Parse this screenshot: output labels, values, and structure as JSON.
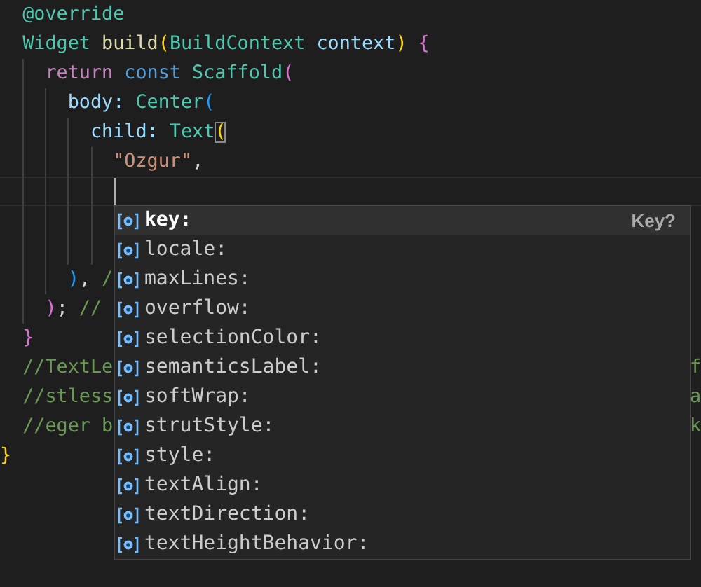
{
  "editor": {
    "lines": [
      {
        "tokens": [
          {
            "text": "  @override",
            "kind": "annotation"
          }
        ]
      },
      {
        "tokens": [
          {
            "text": "  Widget",
            "kind": "type"
          },
          {
            "text": " build",
            "kind": "function"
          },
          {
            "text": "(",
            "kind": "bracket1"
          },
          {
            "text": "BuildContext",
            "kind": "type"
          },
          {
            "text": " context",
            "kind": "variable"
          },
          {
            "text": ")",
            "kind": "bracket1"
          },
          {
            "text": " {",
            "kind": "bracket2"
          }
        ]
      },
      {
        "tokens": [
          {
            "text": "    return",
            "kind": "control"
          },
          {
            "text": " const",
            "kind": "keyword"
          },
          {
            "text": " Scaffold",
            "kind": "type"
          },
          {
            "text": "(",
            "kind": "bracket2"
          }
        ]
      },
      {
        "tokens": [
          {
            "text": "      body:",
            "kind": "variable"
          },
          {
            "text": " Center",
            "kind": "type"
          },
          {
            "text": "(",
            "kind": "bracket3"
          }
        ]
      },
      {
        "tokens": [
          {
            "text": "        child:",
            "kind": "variable"
          },
          {
            "text": " Text",
            "kind": "type"
          },
          {
            "text": "(",
            "kind": "bracket1",
            "matched": true
          }
        ]
      },
      {
        "tokens": [
          {
            "text": "          \"Ozgur\"",
            "kind": "string"
          },
          {
            "text": ",",
            "kind": "plain"
          }
        ]
      },
      {
        "cursor": true
      },
      {
        "tokens": [
          {
            "text": "      )",
            "kind": "bracket3"
          },
          {
            "text": ",",
            "kind": "plain"
          },
          {
            "text": " /",
            "kind": "comment"
          }
        ]
      },
      {
        "tokens": [
          {
            "text": "    )",
            "kind": "bracket2"
          },
          {
            "text": ";",
            "kind": "plain"
          },
          {
            "text": " //",
            "kind": "comment"
          }
        ]
      },
      {
        "tokens": [
          {
            "text": "  }",
            "kind": "bracket2"
          }
        ]
      },
      {
        "tokens": [
          {
            "text": "  //TextLe",
            "kind": "comment"
          }
        ],
        "tail": "f"
      },
      {
        "tokens": [
          {
            "text": "  //stless",
            "kind": "comment"
          }
        ],
        "tail": "a"
      },
      {
        "tokens": [
          {
            "text": "  //eger b",
            "kind": "comment"
          }
        ],
        "tail": "k"
      },
      {
        "tokens": [
          {
            "text": "}",
            "kind": "bracket1"
          }
        ]
      }
    ]
  },
  "suggestions": {
    "items": [
      {
        "label": "key:",
        "selected": true,
        "detail": "Key?"
      },
      {
        "label": "locale:",
        "selected": false
      },
      {
        "label": "maxLines:",
        "selected": false
      },
      {
        "label": "overflow:",
        "selected": false
      },
      {
        "label": "selectionColor:",
        "selected": false
      },
      {
        "label": "semanticsLabel:",
        "selected": false
      },
      {
        "label": "softWrap:",
        "selected": false
      },
      {
        "label": "strutStyle:",
        "selected": false
      },
      {
        "label": "style:",
        "selected": false
      },
      {
        "label": "textAlign:",
        "selected": false
      },
      {
        "label": "textDirection:",
        "selected": false
      },
      {
        "label": "textHeightBehavior:",
        "selected": false
      }
    ]
  }
}
